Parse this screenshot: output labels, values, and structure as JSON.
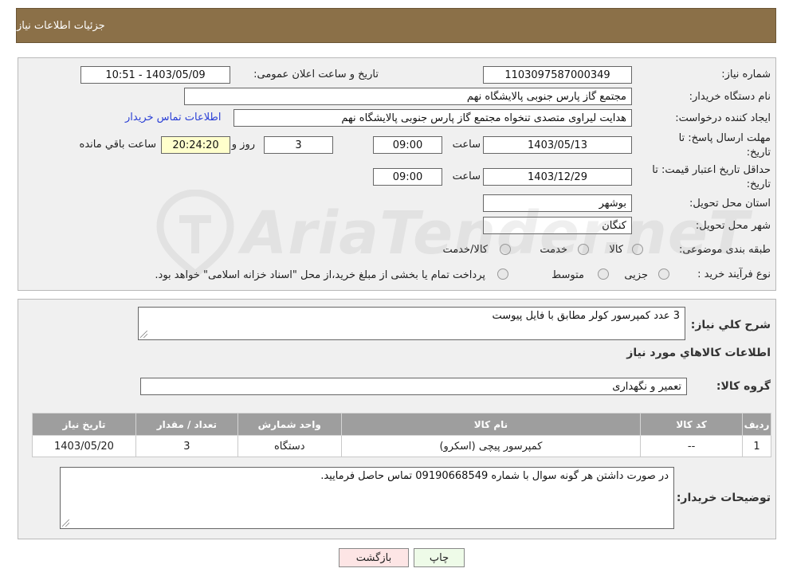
{
  "header": {
    "title": "جزئیات اطلاعات نیاز"
  },
  "form": {
    "need_number_label": "شماره نیاز:",
    "need_number": "1103097587000349",
    "announce_label": "تاریخ و ساعت اعلان عمومی:",
    "announce_value": "1403/05/09 - 10:51",
    "buyer_org_label": "نام دستگاه خریدار:",
    "buyer_org": "مجتمع گاز پارس جنوبی  پالایشگاه نهم",
    "creator_label": "ایجاد کننده درخواست:",
    "creator": "هدایت لیراوی متصدی تنخواه مجتمع گاز پارس جنوبی  پالایشگاه نهم",
    "contact_link": "اطلاعات تماس خریدار",
    "deadline_label_1": "مهلت ارسال پاسخ: تا",
    "deadline_label_2": "تاریخ:",
    "deadline_date": "1403/05/13",
    "time_label": "ساعت",
    "deadline_time": "09:00",
    "days": "3",
    "days_label": "روز و",
    "remaining_time": "20:24:20",
    "remaining_label": "ساعت باقي مانده",
    "validity_label_1": "حداقل تاریخ اعتبار قیمت: تا",
    "validity_label_2": "تاریخ:",
    "validity_date": "1403/12/29",
    "validity_time": "09:00",
    "province_label": "استان محل تحویل:",
    "province": "بوشهر",
    "city_label": "شهر محل تحویل:",
    "city": "کنگان",
    "category_label": "طبقه بندی موضوعی:",
    "category_options": [
      "کالا",
      "خدمت",
      "کالا/خدمت"
    ],
    "process_label": "نوع فرآیند خرید :",
    "process_options": [
      "جزیی",
      "متوسط"
    ],
    "process_note": "پرداخت تمام یا بخشی از مبلغ خرید،از محل \"اسناد خزانه اسلامی\" خواهد بود."
  },
  "details": {
    "summary_label": "شرح کلي نياز:",
    "summary": "3 عدد کمپرسور کولر مطابق با فایل پیوست",
    "items_title": "اطلاعات کالاهاي مورد نياز",
    "group_label": "گروه کالا:",
    "group": "تعمیر و نگهداری",
    "table_headers": [
      "رديف",
      "کد کالا",
      "نام کالا",
      "واحد شمارش",
      "تعداد / مقدار",
      "تاريخ نياز"
    ],
    "rows": [
      [
        "1",
        "--",
        "کمپرسور پیچی (اسکرو)",
        "دستگاه",
        "3",
        "1403/05/20"
      ]
    ],
    "notes_label": "توضیحات خریدار:",
    "notes": "در صورت داشتن هر گونه سوال با شماره 09190668549 تماس حاصل فرمایید."
  },
  "buttons": {
    "print": "چاپ",
    "back": "بازگشت"
  },
  "watermark": {
    "text": "AriaTender.neT"
  }
}
